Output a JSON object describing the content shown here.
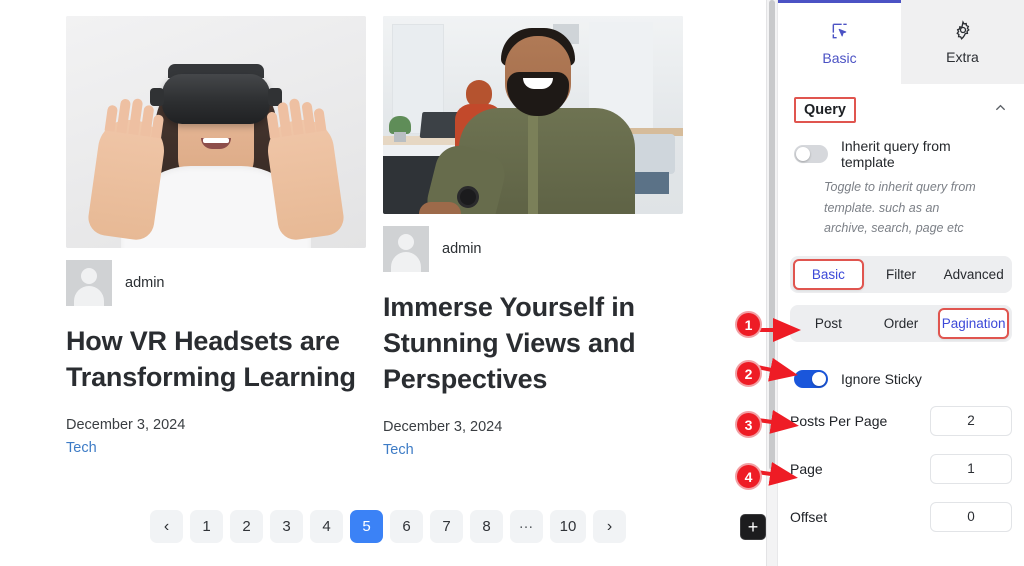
{
  "preview": {
    "posts": [
      {
        "image_alt": "woman-wearing-vr-headset-reaching-out",
        "author": "admin",
        "title": "How VR Headsets are Transforming Learning",
        "date": "December 3, 2024",
        "category": "Tech"
      },
      {
        "image_alt": "smiling-man-in-office-at-laptop",
        "author": "admin",
        "title": "Immerse Yourself in Stunning Views and Perspectives",
        "date": "December 3, 2024",
        "category": "Tech"
      }
    ],
    "pagination": {
      "prev_label": "‹",
      "next_label": "›",
      "pages": [
        "1",
        "2",
        "3",
        "4",
        "5",
        "6",
        "7",
        "8",
        "…",
        "10"
      ],
      "active_page": "5",
      "active_color": "#3b82f6"
    }
  },
  "panel": {
    "tabs": [
      {
        "label": "Basic",
        "icon": "cursor-square-icon",
        "active": true
      },
      {
        "label": "Extra",
        "icon": "gear-icon",
        "active": false
      }
    ],
    "section": {
      "title": "Query",
      "collapse_icon": "chevron-up-icon",
      "highlight_color": "#e0554f"
    },
    "inherit": {
      "label": "Inherit query from template",
      "state": "off",
      "help": "Toggle to inherit query from template. such as an archive, search, page etc"
    },
    "query_tabs": {
      "items": [
        "Basic",
        "Filter",
        "Advanced"
      ],
      "active": "Basic"
    },
    "sub_tabs": {
      "items": [
        "Post",
        "Order",
        "Pagination"
      ],
      "active": "Pagination"
    },
    "pagination_settings": {
      "ignore_sticky": {
        "label": "Ignore Sticky",
        "state": "on",
        "on_color": "#1a56db"
      },
      "fields": [
        {
          "label": "Posts Per Page",
          "value": "2"
        },
        {
          "label": "Page",
          "value": "1"
        },
        {
          "label": "Offset",
          "value": "0"
        }
      ]
    },
    "add_button": {
      "label": "+",
      "icon": "plus-icon"
    }
  },
  "annotations": {
    "color": "#ee1c25",
    "markers": [
      {
        "number": "1",
        "target": "ignore-sticky-toggle"
      },
      {
        "number": "2",
        "target": "posts-per-page-field"
      },
      {
        "number": "3",
        "target": "page-field"
      },
      {
        "number": "4",
        "target": "offset-field"
      }
    ]
  }
}
